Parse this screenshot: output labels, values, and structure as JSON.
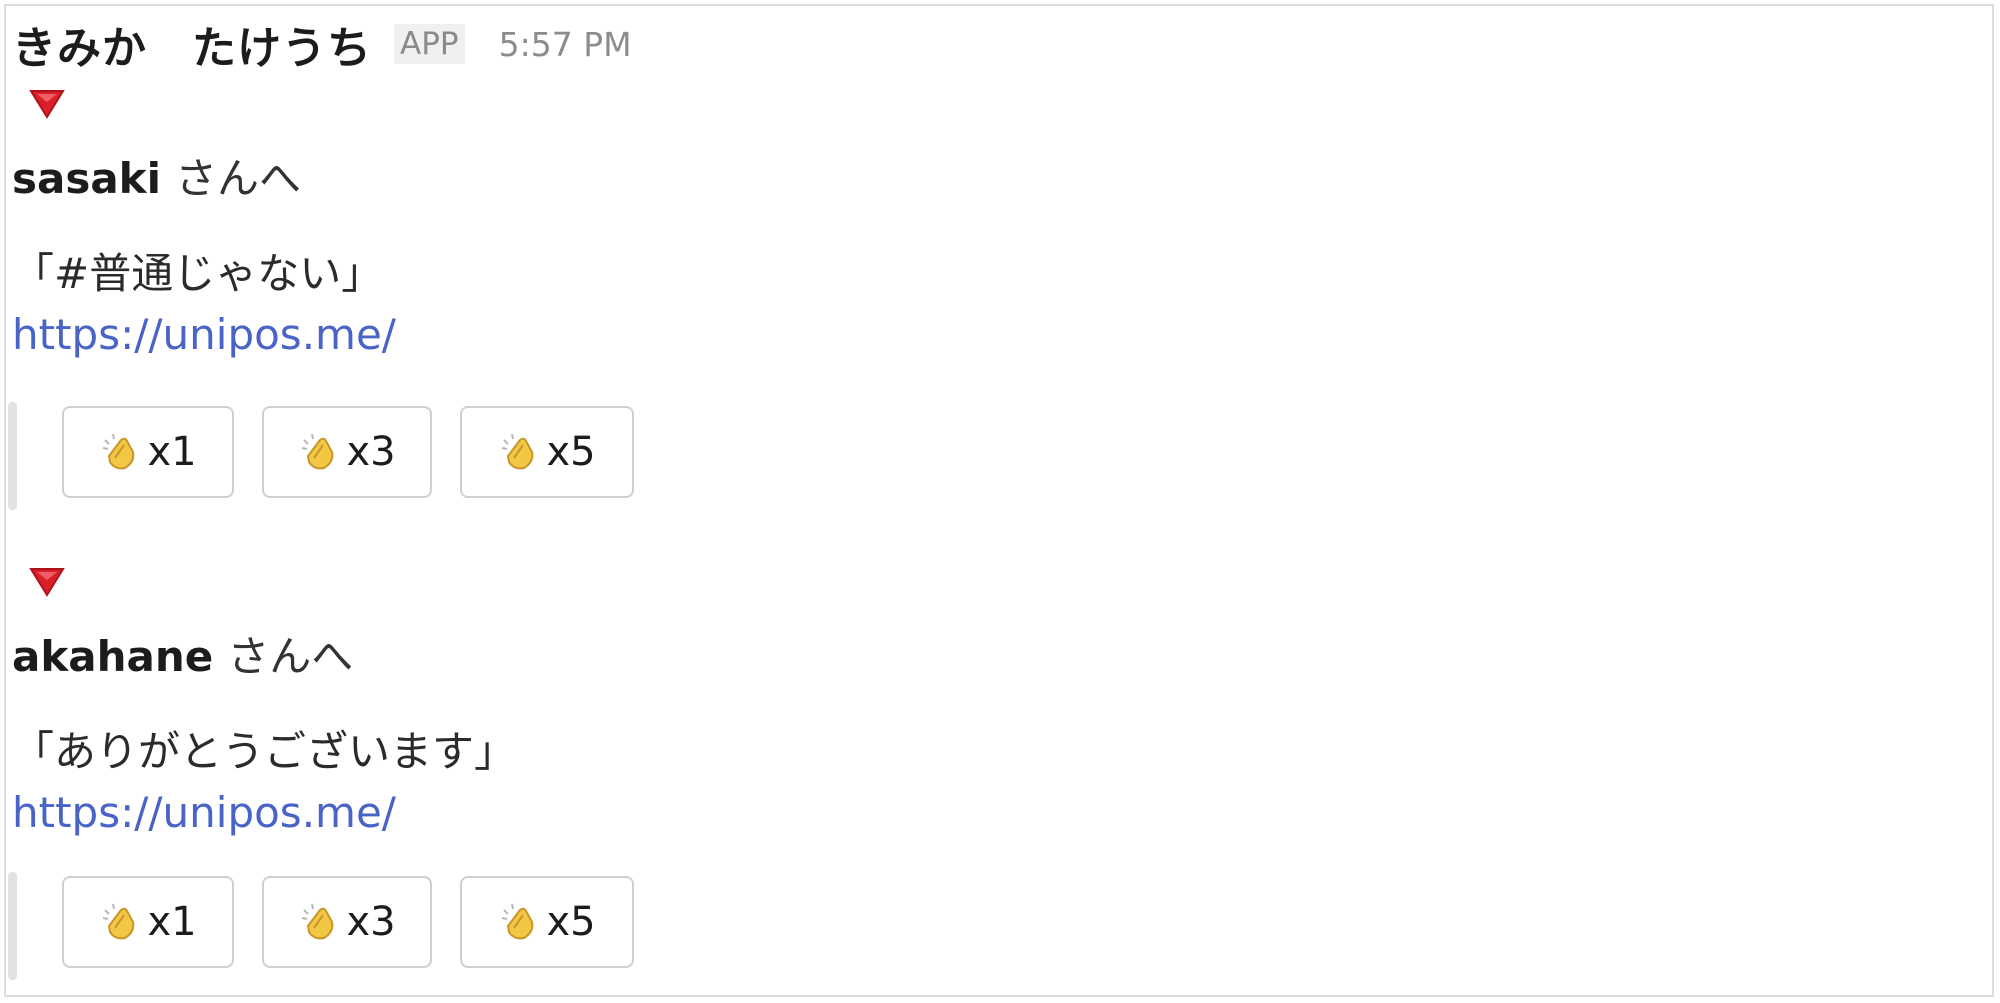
{
  "header": {
    "sender_name": "きみか　たけうち",
    "app_badge": "APP",
    "timestamp": "5:57 PM"
  },
  "messages": [
    {
      "marker_icon": "red-triangle-down",
      "recipient": "sasaki",
      "recipient_suffix": "さんへ",
      "quote": "「#普通じゃない」",
      "link": "https://unipos.me/",
      "buttons": [
        {
          "icon": "clapping-hands",
          "label": "x1"
        },
        {
          "icon": "clapping-hands",
          "label": "x3"
        },
        {
          "icon": "clapping-hands",
          "label": "x5"
        }
      ]
    },
    {
      "marker_icon": "red-triangle-down",
      "recipient": "akahane",
      "recipient_suffix": "さんへ",
      "quote": "「ありがとうございます」",
      "link": "https://unipos.me/",
      "buttons": [
        {
          "icon": "clapping-hands",
          "label": "x1"
        },
        {
          "icon": "clapping-hands",
          "label": "x3"
        },
        {
          "icon": "clapping-hands",
          "label": "x5"
        }
      ]
    }
  ],
  "colors": {
    "marker_red": "#d9202a",
    "link_blue": "#4a63c7",
    "clap_yellow": "#f2c744"
  }
}
